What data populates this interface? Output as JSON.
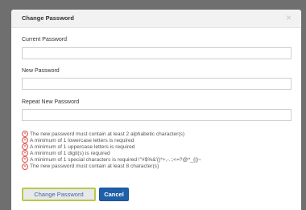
{
  "dialog": {
    "title": "Change Password",
    "close_label": "×"
  },
  "fields": {
    "current_label": "Current Password",
    "current_value": "",
    "new_label": "New Password",
    "new_value": "",
    "repeat_label": "Repeat New Password",
    "repeat_value": ""
  },
  "rules": [
    "The new password must contain at least 2 alphabetic character(s)",
    "A minimum of 1 lowercase letters is required",
    "A minimum of 1 uppercase letters is required",
    "A minimum of 1 digit(s) is required",
    "A minimum of 1 special characters is required !\"#$%&'()*+,-.:;<=?@^_{|}~",
    "The new password must contain at least 8 character(s)"
  ],
  "rule_icon": "error-circle-icon",
  "buttons": {
    "change_label": "Change Password",
    "cancel_label": "Cancel"
  },
  "colors": {
    "accent": "#1f5fa8",
    "error": "#d9534f",
    "focus_outline": "#b9c94a"
  }
}
